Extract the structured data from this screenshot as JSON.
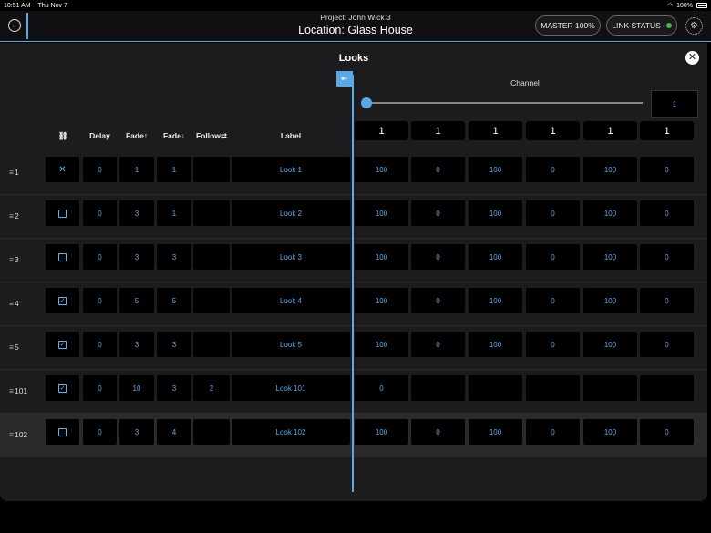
{
  "status_bar": {
    "time": "10:51 AM",
    "date": "Thu Nov 7",
    "battery": "100%"
  },
  "header": {
    "project": "Project: John Wick 3",
    "location": "Location: Glass House",
    "master_label": "MASTER 100%",
    "link_status_label": "LINK STATUS",
    "link_status_color": "#4caf50",
    "icons": {
      "back": "back-arrow-icon",
      "settings": "gear-icon"
    }
  },
  "panel": {
    "title": "Looks",
    "channel_label": "Channel",
    "channel_value": "1",
    "slider_position": 0
  },
  "columns": {
    "link": "⛓",
    "delay": "Delay",
    "fade_up": "Fade↑",
    "fade_down": "Fade↓",
    "follow": "Follow⇄",
    "label": "Label"
  },
  "channel_headers": [
    "1",
    "1",
    "1",
    "1",
    "1",
    "1"
  ],
  "rows": [
    {
      "id": "1",
      "check": "x",
      "delay": "0",
      "fade_up": "1",
      "fade_down": "1",
      "follow": "",
      "label": "Look 1",
      "values": [
        "100",
        "0",
        "100",
        "0",
        "100",
        "0"
      ]
    },
    {
      "id": "2",
      "check": "off",
      "delay": "0",
      "fade_up": "3",
      "fade_down": "1",
      "follow": "",
      "label": "Look 2",
      "values": [
        "100",
        "0",
        "100",
        "0",
        "100",
        "0"
      ]
    },
    {
      "id": "3",
      "check": "off",
      "delay": "0",
      "fade_up": "3",
      "fade_down": "3",
      "follow": "",
      "label": "Look 3",
      "values": [
        "100",
        "0",
        "100",
        "0",
        "100",
        "0"
      ]
    },
    {
      "id": "4",
      "check": "on",
      "delay": "0",
      "fade_up": "5",
      "fade_down": "5",
      "follow": "",
      "label": "Look 4",
      "values": [
        "100",
        "0",
        "100",
        "0",
        "100",
        "0"
      ]
    },
    {
      "id": "5",
      "check": "on",
      "delay": "0",
      "fade_up": "3",
      "fade_down": "3",
      "follow": "",
      "label": "Look 5",
      "values": [
        "100",
        "0",
        "100",
        "0",
        "100",
        "0"
      ]
    },
    {
      "id": "101",
      "check": "on",
      "delay": "0",
      "fade_up": "10",
      "fade_down": "3",
      "follow": "2",
      "label": "Look 101",
      "values": [
        "0",
        "",
        "",
        "",
        "",
        ""
      ]
    },
    {
      "id": "102",
      "check": "off",
      "delay": "0",
      "fade_up": "3",
      "fade_down": "4",
      "follow": "",
      "label": "Look 102",
      "values": [
        "100",
        "0",
        "100",
        "0",
        "100",
        "0"
      ]
    }
  ],
  "selected_row_index": 6,
  "colors": {
    "accent": "#5aa8e6",
    "panel": "#1c1c1e",
    "cell": "#000000"
  }
}
